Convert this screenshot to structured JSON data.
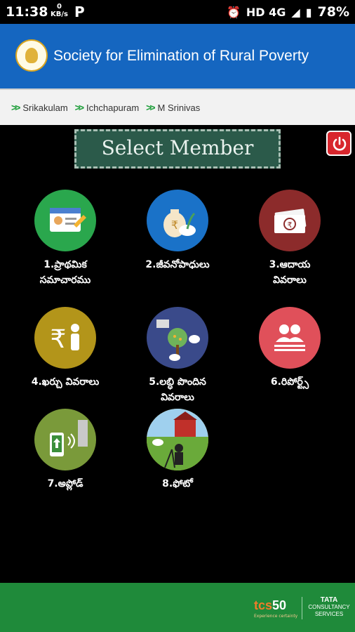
{
  "status_bar": {
    "time": "11:38",
    "net_speed_value": "0",
    "net_speed_unit": "KB/s",
    "network": "HD 4G",
    "battery": "78%"
  },
  "header": {
    "title": "Society for Elimination of Rural Poverty",
    "logo_icon": "emblem-icon"
  },
  "breadcrumb": [
    {
      "label": "Srikakulam"
    },
    {
      "label": "Ichchapuram"
    },
    {
      "label": "M Srinivas"
    }
  ],
  "banner_title": "Select Member",
  "menu": [
    {
      "label_line1": "1.ప్రాథమిక",
      "label_line2": "సమాచారము",
      "icon": "id-card-icon",
      "color": "#2aa74d"
    },
    {
      "label_line1": "2.జీవనోపాధులు",
      "label_line2": "",
      "icon": "money-bag-icon",
      "color": "#1a72c8"
    },
    {
      "label_line1": "3.ఆదాయ",
      "label_line2": "వివరాలు",
      "icon": "cash-notes-icon",
      "color": "#8c2b2b"
    },
    {
      "label_line1": "4.ఖర్చు వివరాలు",
      "label_line2": "",
      "icon": "rupee-person-icon",
      "color": "#b3951a"
    },
    {
      "label_line1": "5.లబ్ధి పొందిన",
      "label_line2": "వివరాలు",
      "icon": "livelihood-assets-icon",
      "color": "#3a4a8a"
    },
    {
      "label_line1": "6.రిపోర్ట్స్",
      "label_line2": "",
      "icon": "users-report-icon",
      "color": "#e0505a"
    },
    {
      "label_line1": "7.అప్లోడ్",
      "label_line2": "",
      "icon": "phone-upload-icon",
      "color": "#7a9a3a"
    },
    {
      "label_line1": "8.ఫోటో",
      "label_line2": "",
      "icon": "photographer-icon",
      "color": "#d8c040"
    }
  ],
  "footer": {
    "brand": "tcs",
    "brand_number": "50",
    "tagline": "Experience certainty",
    "partner_line1": "TATA",
    "partner_line2": "CONSULTANCY",
    "partner_line3": "SERVICES"
  }
}
